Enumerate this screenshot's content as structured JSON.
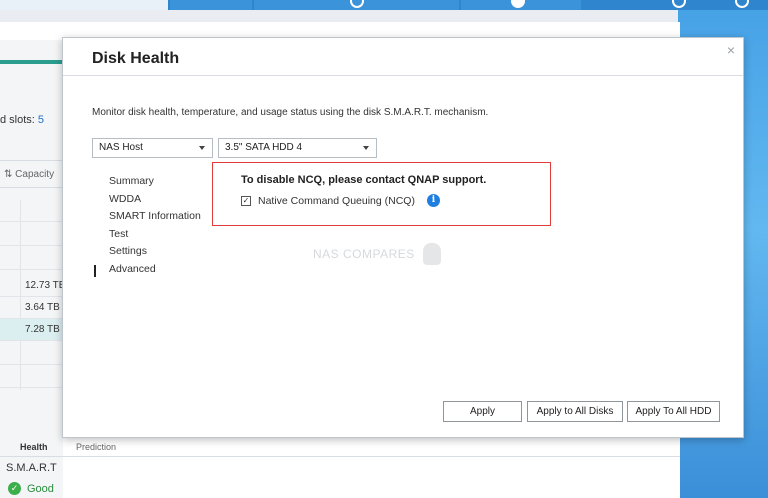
{
  "desktop": {
    "accent_color": "#2f86cf"
  },
  "background_window": {
    "slots_label": "d slots:",
    "slots_value": "5",
    "column_header": "⇅  Capacity",
    "rows": [
      "",
      "",
      "",
      "12.73 TB",
      "3.64 TB",
      "7.28 TB",
      "",
      ""
    ],
    "selected_row_index": 5,
    "bottom_headers": {
      "health": "Health",
      "prediction": "Prediction"
    },
    "smart_label": "S.M.A.R.T",
    "status_value": "Good",
    "status_icon": "check-circle-icon"
  },
  "dialog": {
    "title": "Disk Health",
    "close_glyph": "×",
    "description": "Monitor disk health, temperature, and usage status using the disk S.M.A.R.T. mechanism.",
    "host_select": {
      "value": "NAS Host"
    },
    "disk_select": {
      "value": "3.5\" SATA HDD 4"
    },
    "nav_items": [
      "Summary",
      "WDDA",
      "SMART Information",
      "Test",
      "Settings",
      "Advanced"
    ],
    "active_nav": "Advanced",
    "ncq": {
      "heading": "To disable NCQ, please contact QNAP support.",
      "checkbox_label": "Native Command Queuing (NCQ)",
      "checked": true,
      "highlight_color": "#e03c3c"
    },
    "watermark": "NAS COMPARES",
    "buttons": {
      "apply": "Apply",
      "apply_all_disks": "Apply to All Disks",
      "apply_all_hdd": "Apply To All HDD"
    }
  }
}
